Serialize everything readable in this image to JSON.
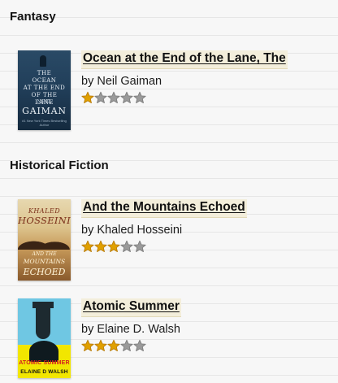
{
  "colors": {
    "star_filled": "#e0a000",
    "star_filled_edge": "#b77800",
    "star_empty": "#9a9a9a",
    "star_empty_edge": "#7b7b7b",
    "title_highlight": "#f3eedb"
  },
  "max_stars": 5,
  "sections": [
    {
      "heading": "Fantasy",
      "books": [
        {
          "title": "Ocean at the End of the Lane, The",
          "author": "by Neil Gaiman",
          "rating": 1,
          "cover": {
            "line1": "THE",
            "line2": "OCEAN",
            "line3": "AT THE END",
            "line4": "OF THE",
            "line5": "LANE",
            "author_first": "NEIL",
            "author_last": "GAIMAN",
            "tagline": "#1 New York Times Bestselling Author"
          }
        }
      ]
    },
    {
      "heading": "Historical Fiction",
      "books": [
        {
          "title": "And the Mountains Echoed",
          "author": "by Khaled Hosseini",
          "rating": 3,
          "cover": {
            "author_first": "KHALED",
            "author_last": "HOSSEINI",
            "line1": "AND THE",
            "line2": "MOUNTAINS",
            "line3": "ECHOED"
          }
        },
        {
          "title": "Atomic Summer",
          "author": "by Elaine D. Walsh",
          "rating": 3,
          "cover": {
            "title": "ATOMIC SUMMER",
            "author": "ELAINE D WALSH"
          }
        }
      ]
    }
  ]
}
